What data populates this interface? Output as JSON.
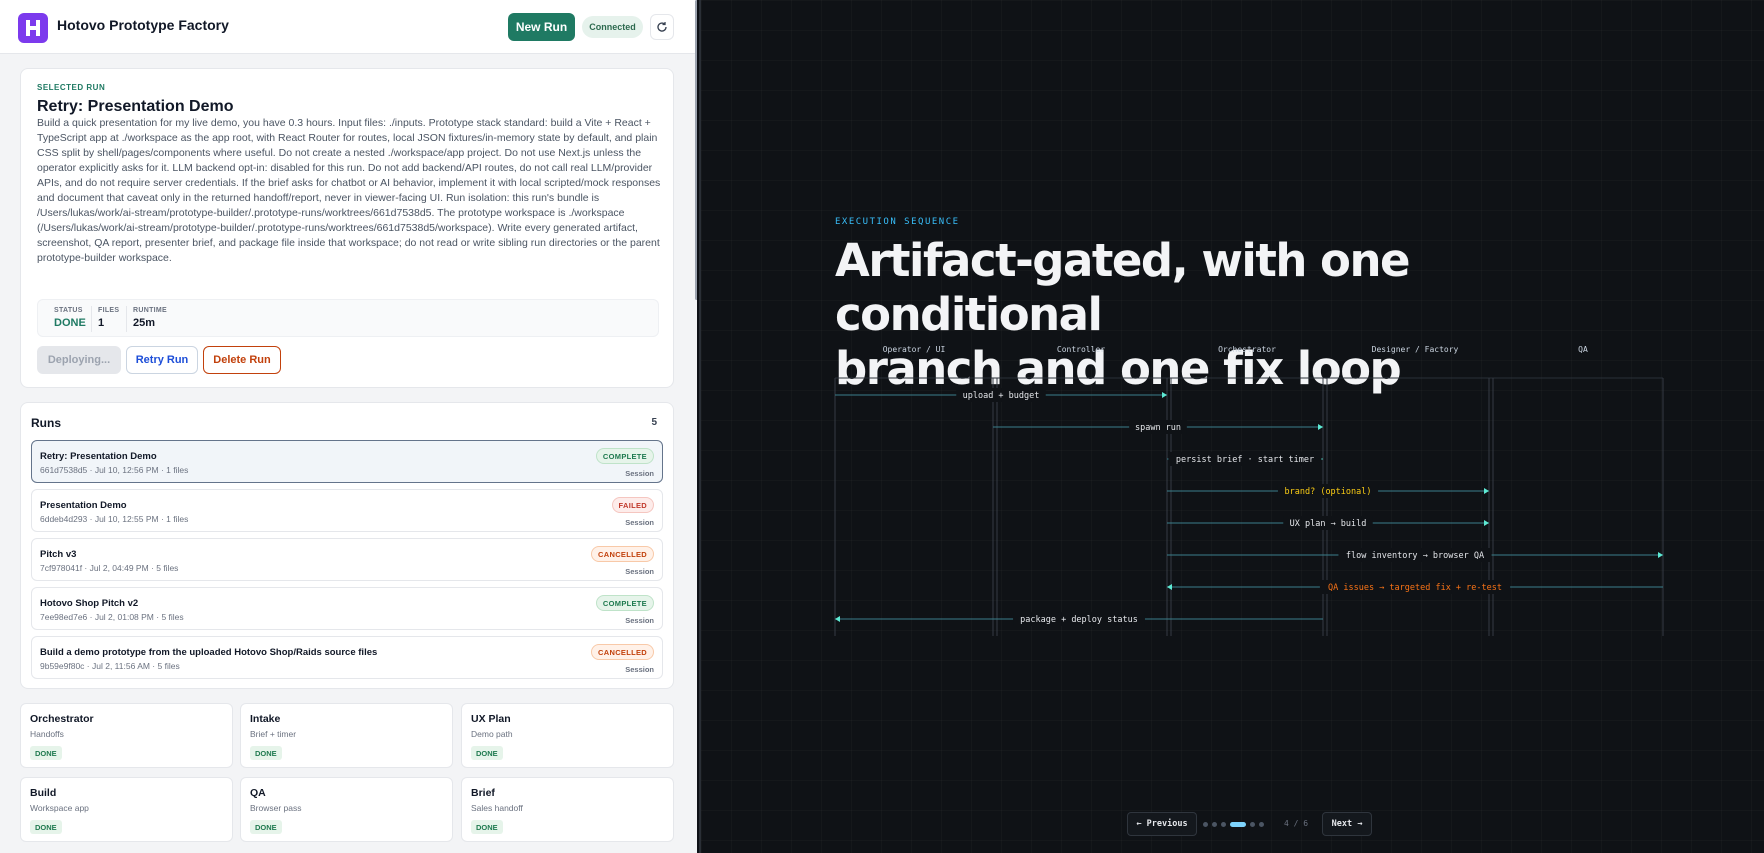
{
  "app": {
    "title": "Hotovo Prototype Factory",
    "new_run_label": "New Run",
    "connection_status": "Connected"
  },
  "selected_run": {
    "eyebrow": "SELECTED RUN",
    "title": "Retry: Presentation Demo",
    "description": "Build a quick presentation for my live demo, you have 0.3 hours. Input files: ./inputs. Prototype stack standard: build a Vite + React + TypeScript app at ./workspace as the app root, with React Router for routes, local JSON fixtures/in-memory state by default, and plain CSS split by shell/pages/components where useful. Do not create a nested ./workspace/app project. Do not use Next.js unless the operator explicitly asks for it. LLM backend opt-in: disabled for this run. Do not add backend/API routes, do not call real LLM/provider APIs, and do not require server credentials. If the brief asks for chatbot or AI behavior, implement it with local scripted/mock responses and document that caveat only in the returned handoff/report, never in viewer-facing UI. Run isolation: this run's bundle is /Users/lukas/work/ai-stream/prototype-builder/.prototype-runs/worktrees/661d7538d5. The prototype workspace is ./workspace (/Users/lukas/work/ai-stream/prototype-builder/.prototype-runs/worktrees/661d7538d5/workspace). Write every generated artifact, screenshot, QA report, presenter brief, and package file inside that workspace; do not read or write sibling run directories or the parent prototype-builder workspace.",
    "stats": {
      "status_label": "STATUS",
      "status_value": "DONE",
      "files_label": "FILES",
      "files_value": "1",
      "runtime_label": "RUNTIME",
      "runtime_value": "25m"
    },
    "actions": {
      "deploying": "Deploying...",
      "retry": "Retry Run",
      "delete": "Delete Run"
    }
  },
  "runs": {
    "heading": "Runs",
    "count": "5",
    "items": [
      {
        "title": "Retry: Presentation Demo",
        "meta": "661d7538d5 · Jul 10, 12:56 PM · 1 files",
        "status": "COMPLETE",
        "kind": "Session"
      },
      {
        "title": "Presentation Demo",
        "meta": "6ddeb4d293 · Jul 10, 12:55 PM · 1 files",
        "status": "FAILED",
        "kind": "Session"
      },
      {
        "title": "Pitch v3",
        "meta": "7cf978041f · Jul 2, 04:49 PM · 5 files",
        "status": "CANCELLED",
        "kind": "Session"
      },
      {
        "title": "Hotovo Shop Pitch v2",
        "meta": "7ee98ed7e6 · Jul 2, 01:08 PM · 5 files",
        "status": "COMPLETE",
        "kind": "Session"
      },
      {
        "title": "Build a demo prototype from the uploaded Hotovo Shop/Raids source files",
        "meta": "9b59e9f80c · Jul 2, 11:56 AM · 5 files",
        "status": "CANCELLED",
        "kind": "Session"
      }
    ]
  },
  "stages": [
    {
      "title": "Orchestrator",
      "subtitle": "Handoffs",
      "status": "DONE"
    },
    {
      "title": "Intake",
      "subtitle": "Brief + timer",
      "status": "DONE"
    },
    {
      "title": "UX Plan",
      "subtitle": "Demo path",
      "status": "DONE"
    },
    {
      "title": "Build",
      "subtitle": "Workspace app",
      "status": "DONE"
    },
    {
      "title": "QA",
      "subtitle": "Browser pass",
      "status": "DONE"
    },
    {
      "title": "Brief",
      "subtitle": "Sales handoff",
      "status": "DONE"
    }
  ],
  "slide": {
    "eyebrow": "EXECUTION SEQUENCE",
    "headline_line1": "Artifact-gated, with one conditional",
    "headline_line2": "branch and one fix loop",
    "lanes": [
      "Operator / UI",
      "Controller",
      "Orchestrator",
      "Designer / Factory",
      "QA"
    ],
    "messages": [
      {
        "label": "upload + budget",
        "from": 0,
        "to": 2,
        "color": "#e5e7eb"
      },
      {
        "label": "spawn run",
        "from": 1,
        "to": 3,
        "color": "#e5e7eb"
      },
      {
        "label": "persist brief · start timer",
        "from": 2,
        "to": 3,
        "color": "#e5e7eb"
      },
      {
        "label": "brand? (optional)",
        "from": 2,
        "to": 4,
        "color": "#facc15"
      },
      {
        "label": "UX plan → build",
        "from": 2,
        "to": 4,
        "color": "#e5e7eb"
      },
      {
        "label": "flow inventory → browser QA",
        "from": 2,
        "to": 5,
        "color": "#e5e7eb"
      },
      {
        "label": "QA issues → targeted fix + re-test",
        "from": 5,
        "to": 2,
        "color": "#f97316"
      },
      {
        "label": "package + deploy status",
        "from": 3,
        "to": 0,
        "color": "#e5e7eb"
      }
    ],
    "pager": {
      "prev": "← Previous",
      "next": "Next →",
      "page": "4 / 6",
      "current": 4,
      "total": 6
    }
  },
  "colors": {
    "accent": "#1f7a63",
    "brand": "#7c3aed",
    "slide_accent": "#38bdf8"
  }
}
